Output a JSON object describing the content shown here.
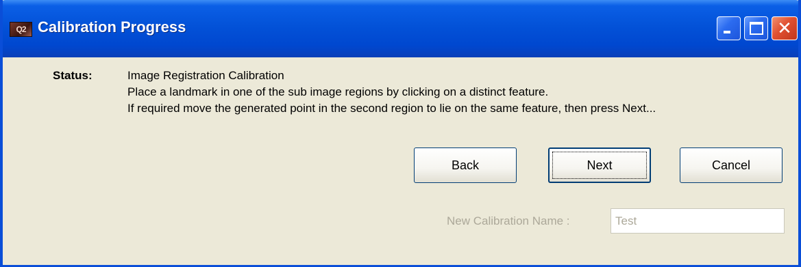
{
  "window": {
    "title": "Calibration Progress",
    "app_icon_text": "Q2"
  },
  "status": {
    "label": "Status:",
    "lines": [
      "Image Registration Calibration",
      "Place a landmark in one of the sub image regions by clicking on a distinct feature.",
      "If required move the generated point in the second region to lie on the same feature, then press Next..."
    ]
  },
  "buttons": {
    "back": "Back",
    "next": "Next",
    "cancel": "Cancel"
  },
  "calibration_name": {
    "label": "New Calibration Name :",
    "value": "Test",
    "enabled": false
  },
  "colors": {
    "titlebar": "#0352d8",
    "dialog_bg": "#ece9d8",
    "disabled_text": "#aca899"
  }
}
